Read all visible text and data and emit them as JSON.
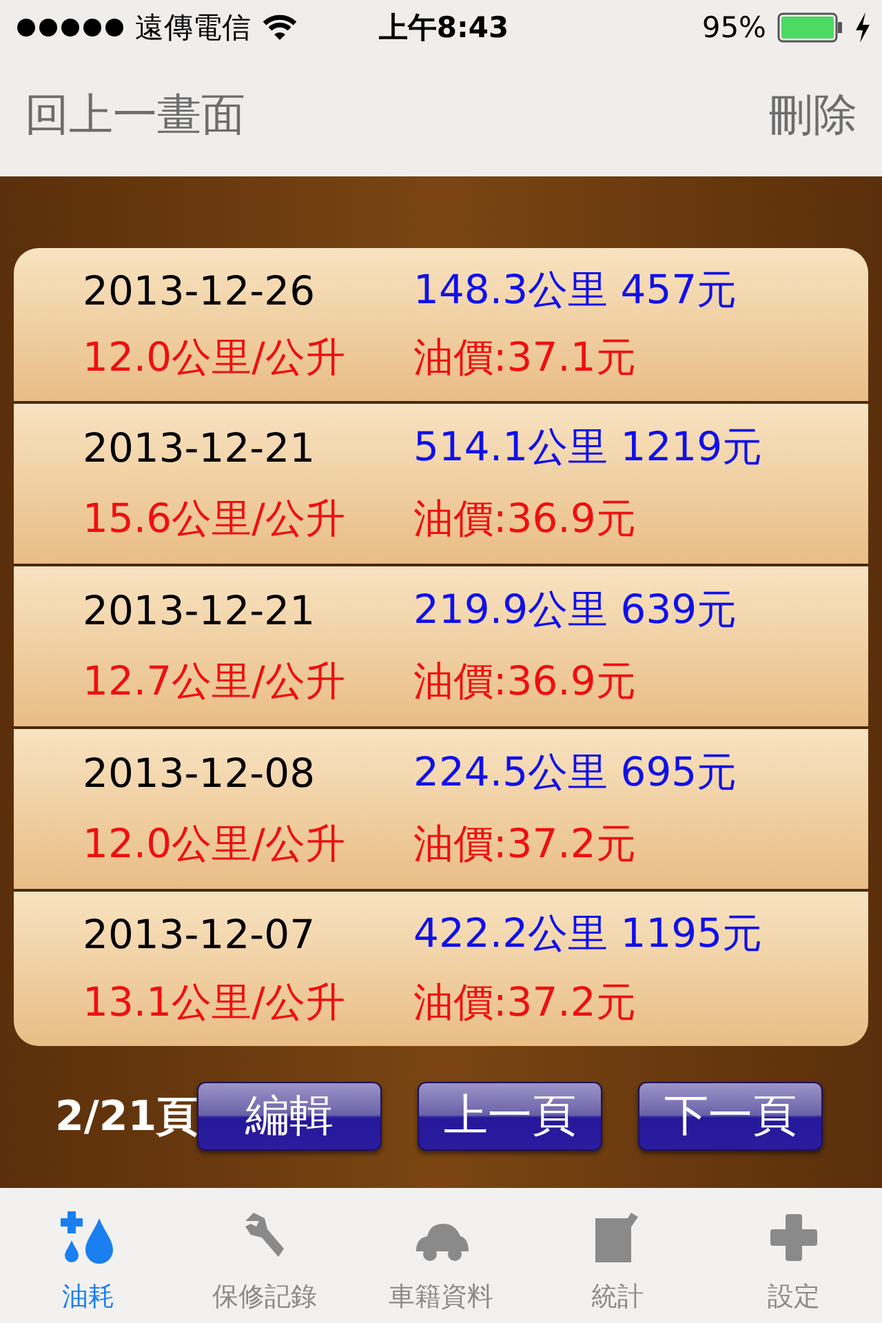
{
  "status_bar": {
    "carrier": "遠傳電信",
    "time": "上午8:43",
    "battery": "95%"
  },
  "nav": {
    "back": "回上一畫面",
    "action": "刪除"
  },
  "records": [
    {
      "date": "2013-12-26",
      "distance_cost": "148.3公里 457元",
      "efficiency": "12.0公里/公升",
      "price": "油價:37.1元"
    },
    {
      "date": "2013-12-21",
      "distance_cost": "514.1公里 1219元",
      "efficiency": "15.6公里/公升",
      "price": "油價:36.9元"
    },
    {
      "date": "2013-12-21",
      "distance_cost": "219.9公里 639元",
      "efficiency": "12.7公里/公升",
      "price": "油價:36.9元"
    },
    {
      "date": "2013-12-08",
      "distance_cost": "224.5公里 695元",
      "efficiency": "12.0公里/公升",
      "price": "油價:37.2元"
    },
    {
      "date": "2013-12-07",
      "distance_cost": "422.2公里 1195元",
      "efficiency": "13.1公里/公升",
      "price": "油價:37.2元"
    }
  ],
  "pager": {
    "page": "2/21頁",
    "buttons": [
      "編輯",
      "上一頁",
      "下一頁"
    ]
  },
  "tabs": [
    {
      "label": "油耗",
      "selected": true
    },
    {
      "label": "保修記錄",
      "selected": false
    },
    {
      "label": "車籍資料",
      "selected": false
    },
    {
      "label": "統計",
      "selected": false
    },
    {
      "label": "設定",
      "selected": false
    }
  ]
}
